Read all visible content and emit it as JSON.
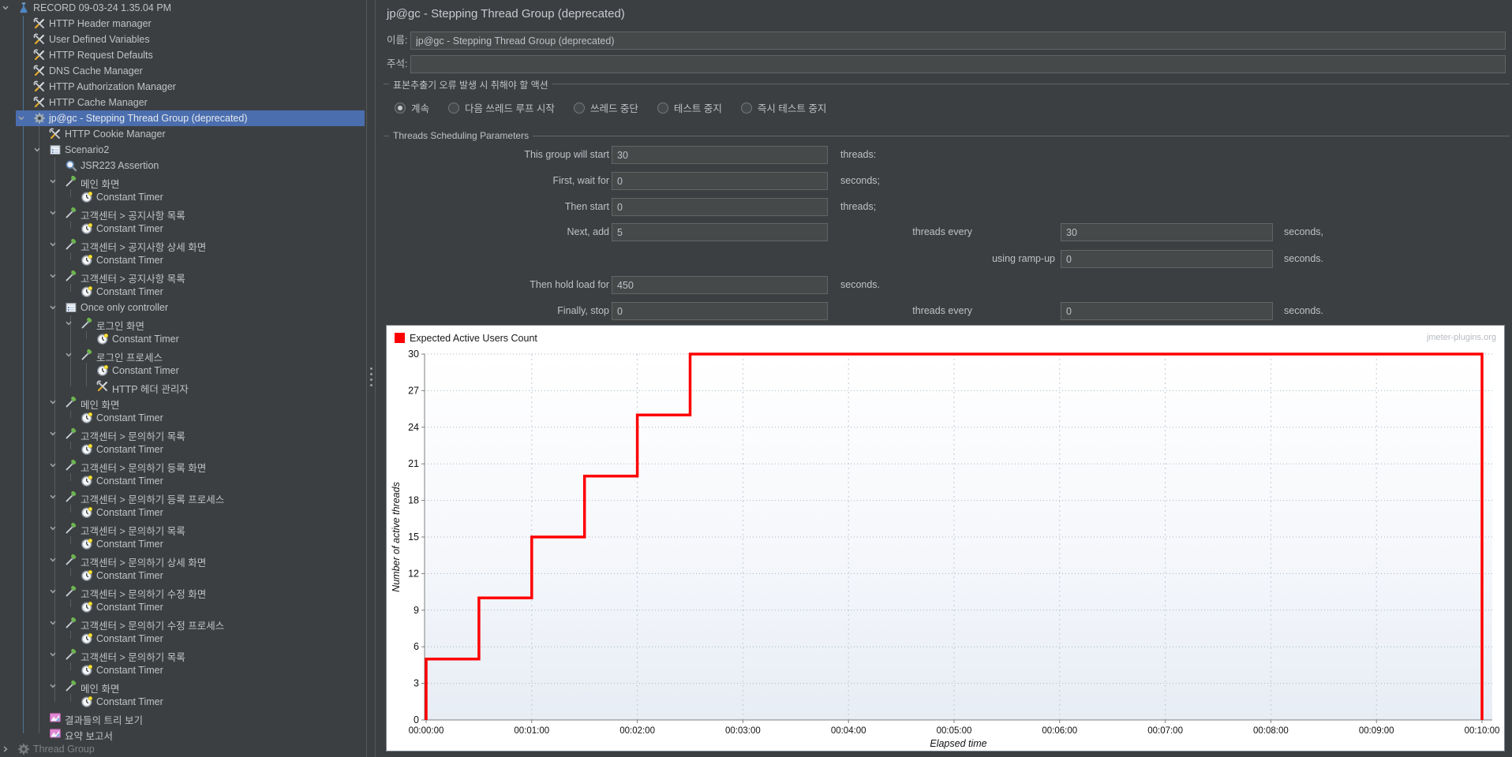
{
  "colors": {
    "selection": "#4b6eaf",
    "panel_bg": "#3c3f41",
    "accent_red": "#ff0000",
    "chart_bg": "#ffffff"
  },
  "tree": {
    "items": [
      {
        "label": "RECORD 09-03-24 1.35.04 PM",
        "icon": "flask",
        "level": 0,
        "chevron": "expanded"
      },
      {
        "label": "HTTP Header manager",
        "icon": "config",
        "level": 1
      },
      {
        "label": "User Defined Variables",
        "icon": "config",
        "level": 1
      },
      {
        "label": "HTTP Request Defaults",
        "icon": "config",
        "level": 1
      },
      {
        "label": "DNS Cache Manager",
        "icon": "config",
        "level": 1
      },
      {
        "label": "HTTP Authorization Manager",
        "icon": "config",
        "level": 1
      },
      {
        "label": "HTTP Cache Manager",
        "icon": "config",
        "level": 1
      },
      {
        "label": "jp@gc - Stepping Thread Group (deprecated)",
        "icon": "gear",
        "level": 1,
        "chevron": "expanded",
        "selected": true
      },
      {
        "label": "HTTP Cookie Manager",
        "icon": "config",
        "level": 2
      },
      {
        "label": "Scenario2",
        "icon": "controller",
        "level": 2,
        "chevron": "expanded"
      },
      {
        "label": "JSR223 Assertion",
        "icon": "assertion",
        "level": 3
      },
      {
        "label": "메인 화면",
        "icon": "sampler",
        "level": 3,
        "chevron": "expanded"
      },
      {
        "label": "Constant Timer",
        "icon": "timer",
        "level": 4
      },
      {
        "label": "고객센터 > 공지사항 목록",
        "icon": "sampler",
        "level": 3,
        "chevron": "expanded"
      },
      {
        "label": "Constant Timer",
        "icon": "timer",
        "level": 4
      },
      {
        "label": "고객센터 > 공지사항 상세 화면",
        "icon": "sampler",
        "level": 3,
        "chevron": "expanded"
      },
      {
        "label": "Constant Timer",
        "icon": "timer",
        "level": 4
      },
      {
        "label": "고객센터 > 공지사항 목록",
        "icon": "sampler",
        "level": 3,
        "chevron": "expanded"
      },
      {
        "label": "Constant Timer",
        "icon": "timer",
        "level": 4
      },
      {
        "label": "Once only controller",
        "icon": "controller",
        "level": 3,
        "chevron": "expanded"
      },
      {
        "label": "로그인 화면",
        "icon": "sampler",
        "level": 4,
        "chevron": "expanded"
      },
      {
        "label": "Constant Timer",
        "icon": "timer",
        "level": 5
      },
      {
        "label": "로그인 프로세스",
        "icon": "sampler",
        "level": 4,
        "chevron": "expanded"
      },
      {
        "label": "Constant Timer",
        "icon": "timer",
        "level": 5
      },
      {
        "label": "HTTP 헤더 관리자",
        "icon": "config",
        "level": 5
      },
      {
        "label": "메인 화면",
        "icon": "sampler",
        "level": 3,
        "chevron": "expanded"
      },
      {
        "label": "Constant Timer",
        "icon": "timer",
        "level": 4
      },
      {
        "label": "고객센터 > 문의하기 목록",
        "icon": "sampler",
        "level": 3,
        "chevron": "expanded"
      },
      {
        "label": "Constant Timer",
        "icon": "timer",
        "level": 4
      },
      {
        "label": "고객센터 > 문의하기 등록 화면",
        "icon": "sampler",
        "level": 3,
        "chevron": "expanded"
      },
      {
        "label": "Constant Timer",
        "icon": "timer",
        "level": 4
      },
      {
        "label": "고객센터 > 문의하기 등록 프로세스",
        "icon": "sampler",
        "level": 3,
        "chevron": "expanded"
      },
      {
        "label": "Constant Timer",
        "icon": "timer",
        "level": 4
      },
      {
        "label": "고객센터 > 문의하기 목록",
        "icon": "sampler",
        "level": 3,
        "chevron": "expanded"
      },
      {
        "label": "Constant Timer",
        "icon": "timer",
        "level": 4
      },
      {
        "label": "고객센터 > 문의하기 상세 화면",
        "icon": "sampler",
        "level": 3,
        "chevron": "expanded"
      },
      {
        "label": "Constant Timer",
        "icon": "timer",
        "level": 4
      },
      {
        "label": "고객센터 > 문의하기 수정 화면",
        "icon": "sampler",
        "level": 3,
        "chevron": "expanded"
      },
      {
        "label": "Constant Timer",
        "icon": "timer",
        "level": 4
      },
      {
        "label": "고객센터 > 문의하기 수정 프로세스",
        "icon": "sampler",
        "level": 3,
        "chevron": "expanded"
      },
      {
        "label": "Constant Timer",
        "icon": "timer",
        "level": 4
      },
      {
        "label": "고객센터 > 문의하기 목록",
        "icon": "sampler",
        "level": 3,
        "chevron": "expanded"
      },
      {
        "label": "Constant Timer",
        "icon": "timer",
        "level": 4
      },
      {
        "label": "메인 화면",
        "icon": "sampler",
        "level": 3,
        "chevron": "expanded"
      },
      {
        "label": "Constant Timer",
        "icon": "timer",
        "level": 4
      },
      {
        "label": "결과들의 트리 보기",
        "icon": "listener",
        "level": 2
      },
      {
        "label": "요약 보고서",
        "icon": "listener",
        "level": 2
      },
      {
        "label": "Thread Group",
        "icon": "gear",
        "level": 0,
        "chevron": "collapsed",
        "dimmed": true
      }
    ]
  },
  "panel": {
    "title": "jp@gc - Stepping Thread Group (deprecated)",
    "name_label": "이름:",
    "name_value": "jp@gc - Stepping Thread Group (deprecated)",
    "comment_label": "주석:",
    "comment_value": "",
    "error_action_group": "표본추출기 오류 발생 시 취해야 할 액션",
    "radios": [
      {
        "label": "계속",
        "selected": true
      },
      {
        "label": "다음 쓰레드 루프 시작",
        "selected": false
      },
      {
        "label": "쓰레드 중단",
        "selected": false
      },
      {
        "label": "테스트 중지",
        "selected": false
      },
      {
        "label": "즉시 테스트 중지",
        "selected": false
      }
    ],
    "scheduling_group": "Threads Scheduling Parameters",
    "sched_rows": [
      {
        "label": "This group will start",
        "value": "30",
        "suffix": "threads:"
      },
      {
        "label": "First, wait for",
        "value": "0",
        "suffix": "seconds;"
      },
      {
        "label": "Then start",
        "value": "0",
        "suffix": "threads;"
      },
      {
        "label": "Next, add",
        "value": "5",
        "label2": "threads every",
        "value2": "30",
        "suffix2": "seconds,"
      },
      {
        "label2": "using ramp-up",
        "value2": "0",
        "suffix2": "seconds."
      },
      {
        "label": "Then hold load for",
        "value": "450",
        "suffix": "seconds."
      },
      {
        "label": "Finally, stop",
        "value": "0",
        "label2": "threads every",
        "value2": "0",
        "suffix2": "seconds."
      }
    ]
  },
  "chart_data": {
    "type": "line",
    "title": "",
    "legend": [
      "Expected Active Users Count"
    ],
    "legend_position": "top-left",
    "series": [
      {
        "name": "Expected Active Users Count",
        "color": "#ff0000",
        "points_sec_threads": [
          [
            0,
            0
          ],
          [
            0,
            5
          ],
          [
            30,
            5
          ],
          [
            30,
            10
          ],
          [
            60,
            10
          ],
          [
            60,
            15
          ],
          [
            90,
            15
          ],
          [
            90,
            20
          ],
          [
            120,
            20
          ],
          [
            120,
            25
          ],
          [
            150,
            25
          ],
          [
            150,
            30
          ],
          [
            600,
            30
          ],
          [
            600,
            0
          ]
        ]
      }
    ],
    "xlabel": "Elapsed time",
    "ylabel": "Number of active threads",
    "xlim_seconds": [
      0,
      600
    ],
    "ylim": [
      0,
      30
    ],
    "y_ticks": [
      0,
      3,
      6,
      9,
      12,
      15,
      18,
      21,
      24,
      27,
      30
    ],
    "x_ticks": [
      {
        "seconds": 0,
        "label": "00:00:00"
      },
      {
        "seconds": 60,
        "label": "00:01:00"
      },
      {
        "seconds": 120,
        "label": "00:02:00"
      },
      {
        "seconds": 180,
        "label": "00:03:00"
      },
      {
        "seconds": 240,
        "label": "00:04:00"
      },
      {
        "seconds": 300,
        "label": "00:05:00"
      },
      {
        "seconds": 360,
        "label": "00:06:00"
      },
      {
        "seconds": 420,
        "label": "00:07:00"
      },
      {
        "seconds": 480,
        "label": "00:08:00"
      },
      {
        "seconds": 540,
        "label": "00:09:00"
      },
      {
        "seconds": 600,
        "label": "00:10:00"
      }
    ],
    "grid": true,
    "watermark": "jmeter-plugins.org"
  }
}
